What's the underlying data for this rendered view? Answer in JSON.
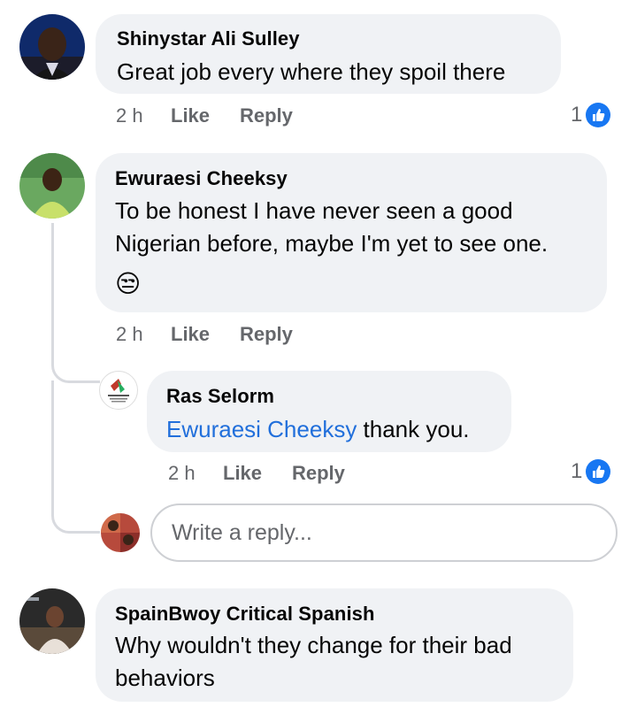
{
  "comments": [
    {
      "author": "Shinystar Ali Sulley",
      "text": "Great job every where they spoil there",
      "time": "2 h",
      "like_label": "Like",
      "reply_label": "Reply",
      "like_count": "1"
    },
    {
      "author": "Ewuraesi Cheeksy",
      "text_line1": "To be honest I have never seen a good",
      "text_line2": "Nigerian before, maybe I'm yet to see one.",
      "emoji": "😒",
      "time": "2 h",
      "like_label": "Like",
      "reply_label": "Reply",
      "replies": [
        {
          "author": "Ras Selorm",
          "mention": "Ewuraesi Cheeksy",
          "text": " thank you.",
          "time": "2 h",
          "like_label": "Like",
          "reply_label": "Reply",
          "like_count": "1"
        }
      ],
      "reply_input": {
        "placeholder": "Write a reply..."
      }
    },
    {
      "author": "SpainBwoy Critical Spanish",
      "text_line1": "Why wouldn't they change for their bad",
      "text_line2": "behaviors"
    }
  ],
  "colors": {
    "bubble": "#f0f2f5",
    "like_blue": "#1877f2",
    "mention": "#216fdb",
    "meta_gray": "#65676b"
  },
  "icons": {
    "like_badge": "thumbs-up-icon"
  }
}
